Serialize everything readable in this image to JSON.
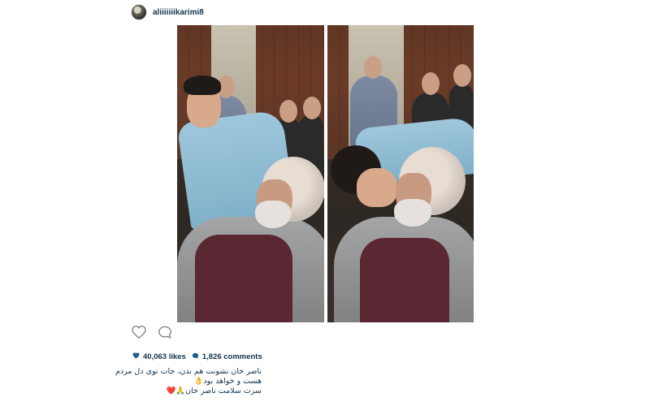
{
  "post": {
    "username": "aliiiiiiikarimi8",
    "likes_text": "40,063 likes",
    "comments_text": "1,826 comments",
    "caption_lines": [
      "ناصر خان نشونت هم ندن، جات توی دل مردم",
      "هست و خواهد بود👌",
      "سرت سلامت ناصر خان🙏❤️"
    ]
  },
  "icons": {
    "avatar": "avatar-icon",
    "like": "heart-outline-icon",
    "comment": "speech-bubble-icon",
    "likes_stat": "heart-filled-icon",
    "comments_stat": "chat-bubble-filled-icon"
  },
  "colors": {
    "text": "#11344f",
    "icon_stat": "#1f5f8b",
    "background": "#ffffff"
  }
}
